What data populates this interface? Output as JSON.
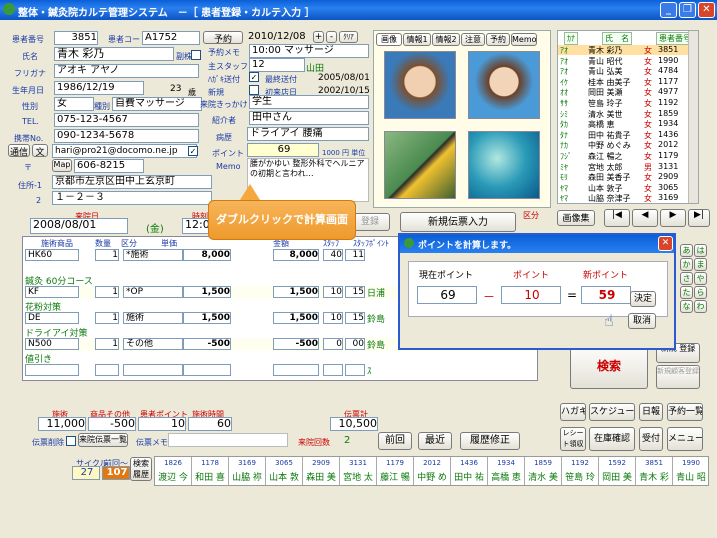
{
  "window": {
    "title": "整体・鍼灸院カルテ管理システム　－［ 患者登録・カルテ入力 ］"
  },
  "patient": {
    "num_label": "患者番号",
    "num": "3851",
    "code_label": "患者コード",
    "code": "A1752",
    "name_label": "氏名",
    "name": "青木 彩乃",
    "kanji_label": "副株",
    "kana_label": "フリガナ",
    "kana": "アオキ アヤノ",
    "birth_label": "生年月日",
    "birth": "1986/12/19",
    "age": "23",
    "age_unit": "歳",
    "sex_label": "性別",
    "sex": "女",
    "type_label": "種別",
    "type": "自費マッサージ",
    "tel_label": "TEL.",
    "tel": "075-123-4567",
    "mobile_label": "携帯No.",
    "mobile": "090-1234-5678",
    "mail_btn": "通信",
    "text_btn": "文",
    "mail": "hari@pro21@docomo.ne.jp",
    "zip_label": "〒",
    "map_btn": "Map",
    "zip": "606-8215",
    "addr1_label": "住所-1",
    "addr1": "京都市左京区田中上玄京町",
    "addr2_label": "2",
    "addr2": "１－２－３"
  },
  "visit": {
    "yoyaku_btn": "予約",
    "date": "2010/12/08",
    "plus": "+",
    "minus": "-",
    "clear": "ｸﾘｱ",
    "memo_label": "予約メモ",
    "memo": "10:00 マッサージ",
    "staff_label": "主スタッフ",
    "staff_num": "12",
    "staff_name": "山田",
    "haishin_label": "ﾊｶﾞｷ送付",
    "last_label": "最終送付",
    "last_date": "2005/08/01",
    "new_label": "新規",
    "first_label": "初来店日",
    "first_date": "2002/10/15",
    "reason_label": "来院きっかけ",
    "reason": "学生",
    "intro_label": "紹介者",
    "intro": "田中さん",
    "illness_label": "病歴",
    "illness": "ドライアイ 腰痛",
    "point_label": "ポイント",
    "point": "69",
    "point_rate": "1000 円 単位",
    "memo2_label": "Memo",
    "memo2": "腰がかゆい 整形外科でヘルニアの初期と言われ…"
  },
  "photo_tabs": [
    "画像",
    "情報1",
    "情報2",
    "注意",
    "予約",
    "Memo"
  ],
  "namelist": {
    "headers": [
      "ｶﾅ",
      "氏　名",
      "",
      "患者番号"
    ],
    "rows": [
      [
        "ｱｵ",
        "青木 彩乃",
        "女",
        "3851"
      ],
      [
        "ｱｵ",
        "青山 昭代",
        "女",
        "1990"
      ],
      [
        "ｱｵ",
        "青山 弘美",
        "女",
        "4784"
      ],
      [
        "ｲｹ",
        "桂本 由美子",
        "女",
        "1177"
      ],
      [
        "ｵｵ",
        "岡田 美瀬",
        "女",
        "4977"
      ],
      [
        "ｻｻ",
        "笹島 玲子",
        "女",
        "1192"
      ],
      [
        "ｼﾐ",
        "清水 美世",
        "女",
        "1859"
      ],
      [
        "ﾀｶ",
        "高橋 恵",
        "女",
        "1934"
      ],
      [
        "ﾀﾅ",
        "田中 祐貴子",
        "女",
        "1436"
      ],
      [
        "ﾅｶ",
        "中野 めぐみ",
        "女",
        "2012"
      ],
      [
        "ﾌｼﾞ",
        "森江 暢之",
        "女",
        "1179"
      ],
      [
        "ﾐﾔ",
        "宮地 太郎",
        "男",
        "3131"
      ],
      [
        "ﾓﾘ",
        "森田 美香子",
        "女",
        "2909"
      ],
      [
        "ﾔﾏ",
        "山本 敦子",
        "女",
        "3065"
      ],
      [
        "ﾔﾏ",
        "山脇 奈津子",
        "女",
        "3169"
      ]
    ]
  },
  "imgnav": {
    "btn": "画像集",
    "first": "|◀",
    "prev": "◀",
    "next": "▶",
    "last": "▶|"
  },
  "visit_row": {
    "date_label": "来院日",
    "date": "2008/08/01",
    "dow": "(金)",
    "time_label": "時刻",
    "time": "12:00",
    "reg_btn": "登録",
    "new_slip": "新規伝票入力",
    "kind_label": "区分"
  },
  "tooltip": "ダブルクリックで計算画面",
  "table": {
    "headers": [
      "施術商品",
      "数量",
      "区分",
      "単価",
      "金額",
      "ｽﾀｯﾌ",
      "ｽﾀｯﾌﾎﾟｲﾝﾄ"
    ],
    "rows": [
      {
        "sec": "",
        "item": "HK60",
        "qty": "1",
        "kind": "*施術",
        "unit": "8,000",
        "amt": "8,000",
        "staff": "40",
        "spt": "11"
      },
      {
        "sec": "鍼灸 60分コース",
        "item": "KF",
        "qty": "1",
        "kind": "*OP",
        "unit": "1,500",
        "amt": "1,500",
        "staff": "10",
        "spt": "15",
        "staffname": "日浦"
      },
      {
        "sec": "花粉対策",
        "item": "DE",
        "qty": "1",
        "kind": "施術",
        "unit": "1,500",
        "amt": "1,500",
        "staff": "10",
        "spt": "15",
        "staffname": "鈴島"
      },
      {
        "sec": "ドライアイ対策",
        "item": "N500",
        "qty": "1",
        "kind": "その他",
        "unit": "-500",
        "amt": "-500",
        "staff": "0",
        "spt": "00",
        "staffname": "鈴島"
      },
      {
        "sec": "値引き",
        "item": "",
        "qty": "",
        "kind": "",
        "unit": "",
        "amt": "",
        "staff": "",
        "spt": "",
        "staffname": "ｽ"
      }
    ]
  },
  "totals": {
    "sej_label": "施術",
    "sej": "11,000",
    "goods_label": "商品その他",
    "goods": "-500",
    "pt_label": "患者ポイント",
    "pt": "10",
    "time_label": "施術時間",
    "time": "60",
    "total_label": "伝票計",
    "total": "10,500"
  },
  "slipbar": {
    "del_label": "伝票削除",
    "past_btn": "来院伝票一覧",
    "memo_label": "伝票メモ",
    "count_label": "来院回数",
    "count": "2",
    "prev": "前回",
    "latest": "最近",
    "history": "履歴修正"
  },
  "rightbtns": {
    "kana": [
      "あ",
      "か",
      "さ",
      "た",
      "な",
      "は",
      "ま",
      "や",
      "ら",
      "わ"
    ],
    "search": "検索",
    "newreg": "新規 登録",
    "newreg2": "新規顧客登録",
    "hagaki": "ハガキ",
    "sched": "スケジュール",
    "daily": "日報",
    "ylist": "予約一覧",
    "receipt": "レシート領収書",
    "stock": "在庫確認",
    "reception": "受付",
    "menu": "メニュー"
  },
  "bottom": {
    "cycle_label": "サイクル",
    "cycle": "27",
    "prev_label": "前回～",
    "prev": "107",
    "hist_btn": "検索履歴",
    "cells": [
      [
        "1826",
        "渡辺 今"
      ],
      [
        "1178",
        "和田 喜"
      ],
      [
        "3169",
        "山脇 祢"
      ],
      [
        "3065",
        "山本 敦"
      ],
      [
        "2909",
        "森田 美"
      ],
      [
        "3131",
        "宮地 太"
      ],
      [
        "1179",
        "藤江 暢"
      ],
      [
        "2012",
        "中野 め"
      ],
      [
        "1436",
        "田中 祐"
      ],
      [
        "1934",
        "高橋 恵"
      ],
      [
        "1859",
        "清水 美"
      ],
      [
        "1192",
        "笹島 玲"
      ],
      [
        "1592",
        "岡田 美"
      ],
      [
        "3851",
        "青木 彩"
      ],
      [
        "1990",
        "青山 昭"
      ]
    ]
  },
  "dialog": {
    "title": "ポイントを計算します。",
    "cur_label": "現在ポイント",
    "cur": "69",
    "minus": "－",
    "pt_label": "ポイント",
    "pt": "10",
    "eq": "=",
    "new_label": "新ポイント",
    "new": "59",
    "ok": "決定",
    "cancel": "取消"
  },
  "colors": {
    "blue_label": "#1a3aa6",
    "yellow_field": "#ffffd0",
    "red": "#cc0000",
    "tooltip": "#f5a83c"
  }
}
